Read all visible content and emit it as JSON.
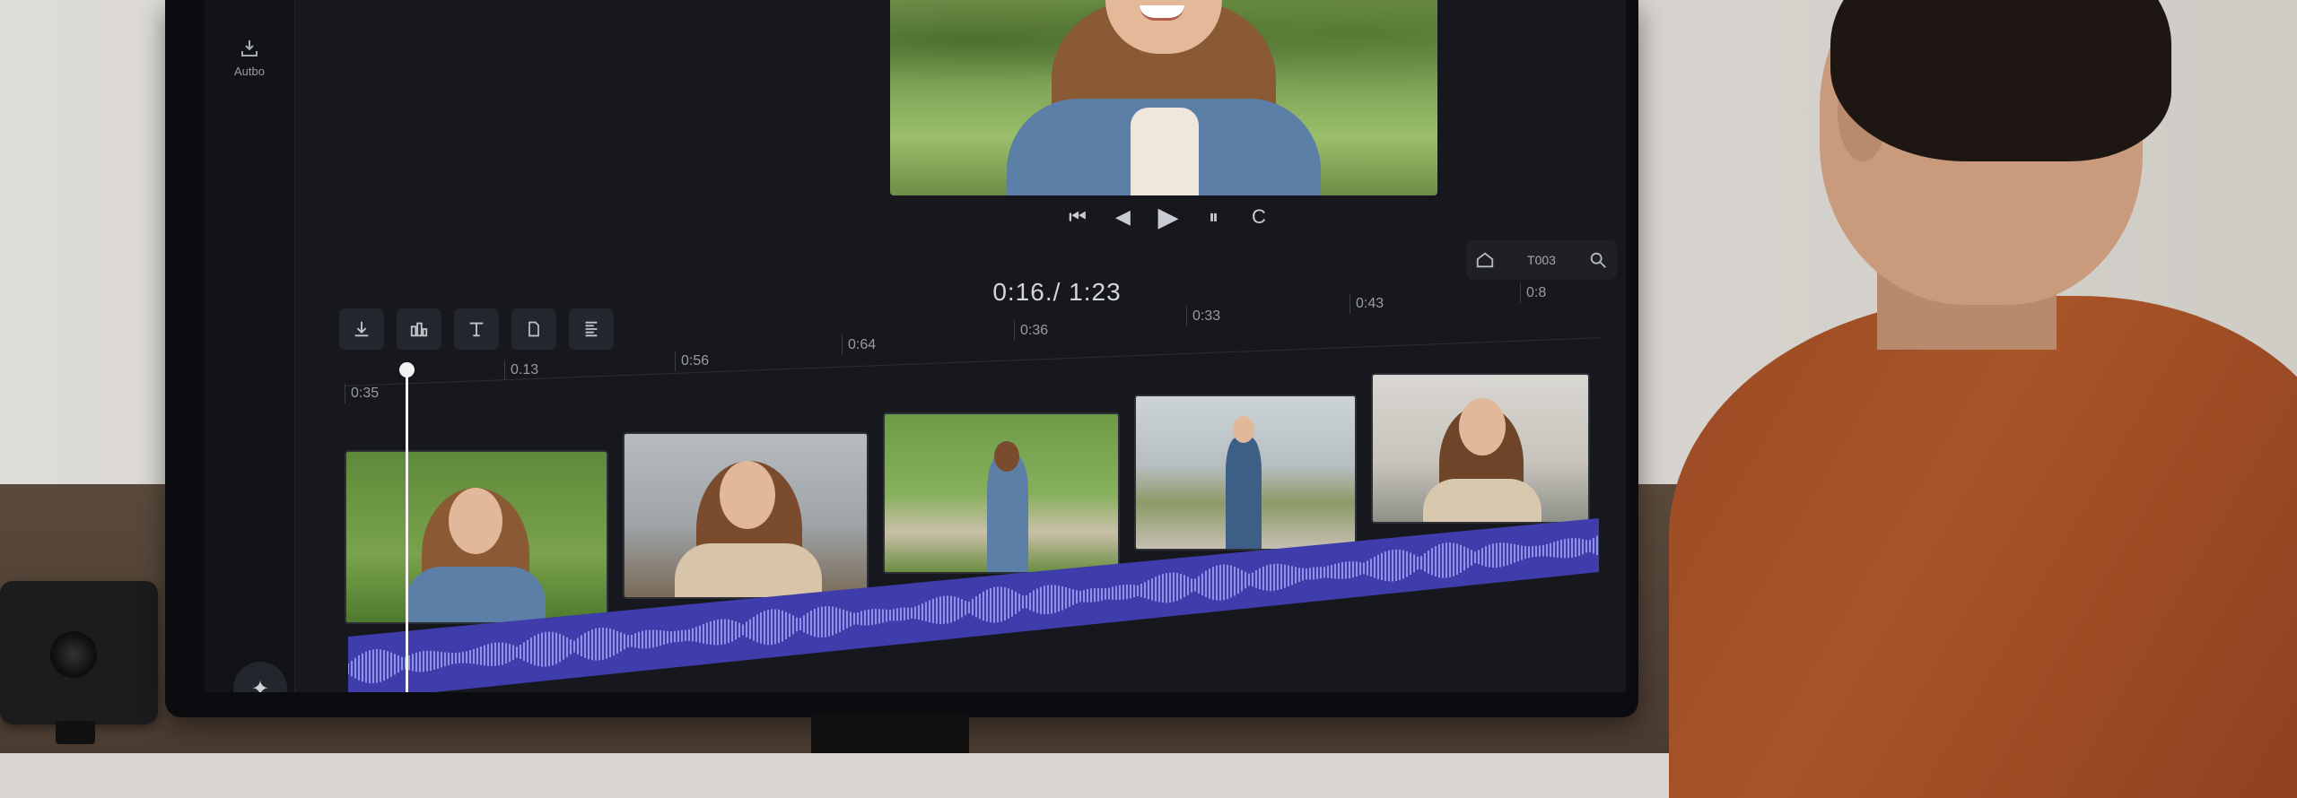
{
  "app": {
    "sidebar": {
      "tool_label": "Autbo",
      "fab_icon": "sparkle-icon"
    },
    "transport": {
      "buttons": [
        "skip-back-icon",
        "step-back-icon",
        "play-icon",
        "pause-icon",
        "loop-icon"
      ],
      "labels": {
        "skip_back": "⏮",
        "step_back": "◀",
        "play": "▶",
        "pause": "⏸",
        "loop": "C"
      }
    },
    "view_controls": {
      "home_icon": "home-icon",
      "code": "T003",
      "search_icon": "search-icon"
    },
    "timecode": "0:16./ 1:23",
    "toolbar": {
      "buttons": [
        "download-icon",
        "clip-tools-icon",
        "text-tool-icon",
        "page-icon",
        "list-icon"
      ]
    },
    "ruler": {
      "ticks": [
        "0:35",
        "0.13",
        "0:56",
        "0:64",
        "0:36",
        "0:33",
        "0:43",
        "0:8"
      ]
    },
    "timeline": {
      "clips": [
        {
          "name": "clip-1",
          "description": "woman smiling outdoors"
        },
        {
          "name": "clip-2",
          "description": "woman smiling near house"
        },
        {
          "name": "clip-3",
          "description": "woman walking on path"
        },
        {
          "name": "clip-4",
          "description": "man walking"
        },
        {
          "name": "clip-5",
          "description": "woman indoors"
        }
      ],
      "audio_color": "#3f3dab"
    }
  }
}
